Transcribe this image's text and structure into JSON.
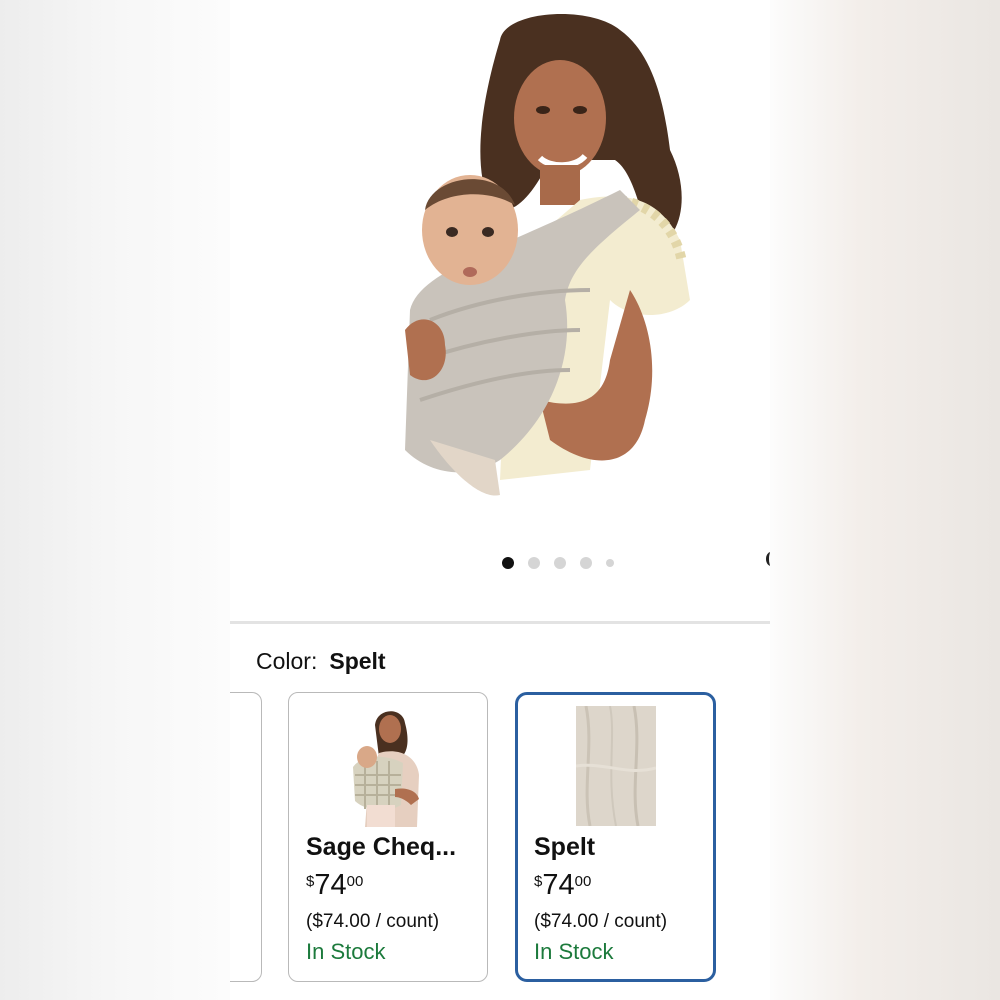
{
  "product": {
    "image_icon": "mother-with-baby-in-wrap-image",
    "carousel": {
      "total": 5,
      "active": 1
    }
  },
  "color_selector": {
    "label": "Color:",
    "selected": "Spelt"
  },
  "variants": [
    {
      "name": "Sage Cheq...",
      "price_symbol": "$",
      "price_whole": "74",
      "price_cents": "00",
      "unit_price": "($74.00 / count)",
      "availability": "In Stock",
      "thumb_icon": "sage-checker-wrap-thumbnail"
    },
    {
      "name": "Spelt",
      "price_symbol": "$",
      "price_whole": "74",
      "price_cents": "00",
      "unit_price": "($74.00 / count)",
      "availability": "In Stock",
      "thumb_icon": "spelt-fabric-swatch-thumbnail",
      "selected": true
    }
  ],
  "colors": {
    "selected_border": "#2b5fa0",
    "in_stock": "#1c7a3c",
    "active_dot": "#111111",
    "inactive_dot": "#d5d5d5"
  }
}
